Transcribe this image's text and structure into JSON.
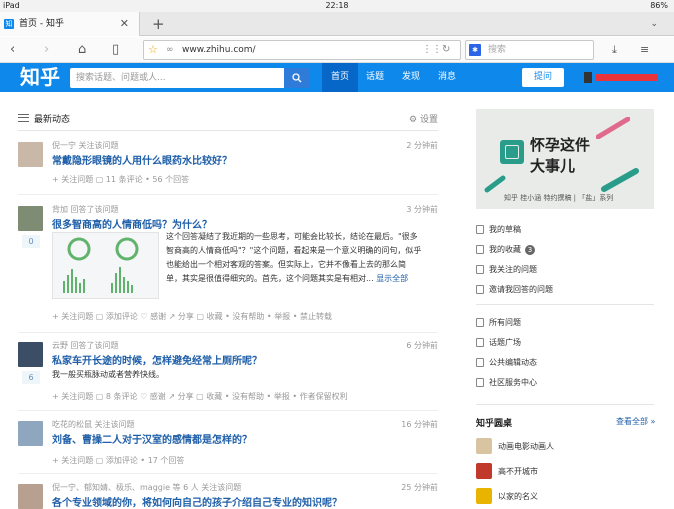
{
  "statusbar": {
    "device": "iPad",
    "time": "22:18",
    "battery": "86%"
  },
  "browser": {
    "tab_title": "首页 - 知乎",
    "tab_favicon": "知",
    "url": "www.zhihu.com/",
    "search_placeholder": "搜索"
  },
  "zhihu": {
    "logo": "知乎",
    "search_placeholder": "搜索话题、问题或人...",
    "nav": [
      "首页",
      "话题",
      "发现",
      "消息"
    ],
    "ask_label": "提问"
  },
  "feed": {
    "header": "最新动态",
    "settings_label": "设置",
    "items": [
      {
        "meta": "倪一宁 关注该问题",
        "time": "2 分钟前",
        "question": "常戴隐形眼镜的人用什么眼药水比较好？",
        "actions": "+ 关注问题  ▢ 11 条评论 • 56 个回答"
      },
      {
        "meta": "背加 回答了该问题",
        "time": "3 分钟前",
        "question": "很多智商高的人情商低吗？为什么？",
        "vote": "0",
        "excerpt1": "这个回答凝结了我近期的一些思考，可能会比较长，结论在最后。\"很多",
        "excerpt2": "智商高的人情商低吗\"？\"这个问题，看起来是一个意义明确的问句，似乎",
        "excerpt3": "也能给出一个相对客观的答案。但实际上，它并不像看上去的那么简",
        "excerpt4": "单，其实是很值得细究的。首先，这个问题其实是有相对...",
        "more": "显示全部",
        "actions": "+ 关注问题  ▢ 添加评论  ♡ 感谢  ↗ 分享  ▢ 收藏 • 没有帮助 • 举报 • 禁止转载"
      },
      {
        "meta": "云野 回答了该问题",
        "time": "6 分钟前",
        "question": "私家车开长途的时候，怎样避免经常上厕所呢？",
        "vote": "6",
        "excerpt1": "我一般买瓶脉动或者营养快线。",
        "actions": "+ 关注问题  ▢ 8 条评论  ♡ 感谢  ↗ 分享  ▢ 收藏 • 没有帮助 • 举报 • 作者保留权利"
      },
      {
        "meta": "吃花的松鼠 关注该问题",
        "time": "16 分钟前",
        "question": "刘备、曹操二人对于汉室的感情都是怎样的？",
        "actions": "+ 关注问题  ▢ 添加评论 • 17 个回答"
      },
      {
        "meta": "倪一宁、郁知婧、极乐、maggie 等 6 人 关注该问题",
        "time": "25 分钟前",
        "question": "各个专业领域的你，将如何向自己的孩子介绍自己专业的知识呢？"
      }
    ]
  },
  "sidebar": {
    "banner": {
      "title1": "怀孕这件",
      "title2": "大事儿",
      "caption": "知乎 桂小涵 特约撰稿 | 「盐」系列"
    },
    "links1": [
      {
        "label": "我的草稿"
      },
      {
        "label": "我的收藏",
        "badge": "3"
      },
      {
        "label": "我关注的问题"
      },
      {
        "label": "邀请我回答的问题"
      }
    ],
    "links2": [
      {
        "label": "所有问题"
      },
      {
        "label": "话题广场"
      },
      {
        "label": "公共编辑动态"
      },
      {
        "label": "社区服务中心"
      }
    ],
    "roundtable_title": "知乎圆桌",
    "roundtable_all": "查看全部 »",
    "roundtables": [
      {
        "label": "动画电影动画人"
      },
      {
        "label": "高不开城市"
      },
      {
        "label": "以家的名义"
      }
    ]
  },
  "colors": {
    "brand": "#0f88eb",
    "link": "#1e5ea8"
  }
}
